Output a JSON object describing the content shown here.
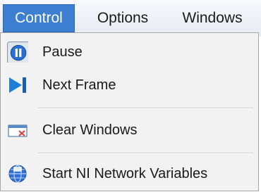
{
  "menubar": {
    "items": [
      {
        "label": "Control",
        "active": true
      },
      {
        "label": "Options",
        "active": false
      },
      {
        "label": "Windows",
        "active": false
      }
    ]
  },
  "menu": {
    "items": [
      {
        "label": "Pause",
        "icon": "pause-icon",
        "checked": true
      },
      {
        "label": "Next Frame",
        "icon": "next-frame-icon"
      },
      {
        "label": "Clear Windows",
        "icon": "clear-windows-icon"
      },
      {
        "label": "Start NI Network Variables",
        "icon": "network-variables-icon"
      }
    ]
  },
  "colors": {
    "active_menu": "#3c7fd1",
    "icon_blue": "#1c7ed6"
  }
}
